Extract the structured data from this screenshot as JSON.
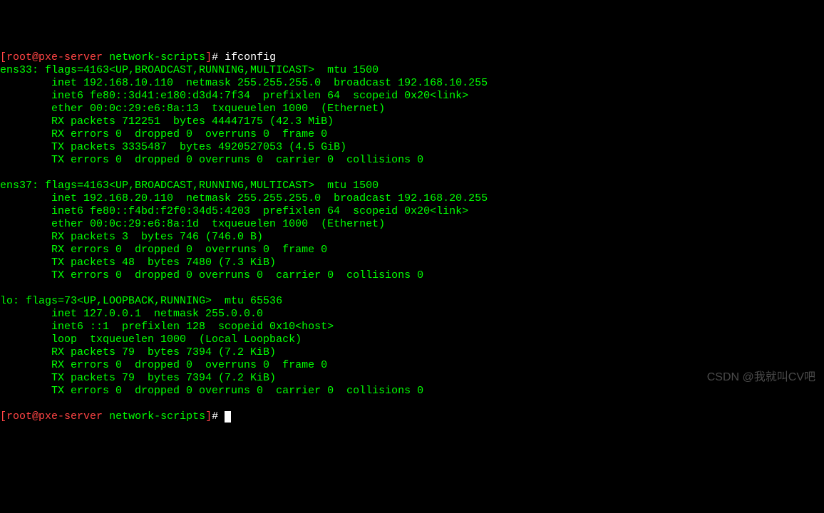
{
  "prompt1": {
    "open": "[",
    "user": "root",
    "at": "@",
    "host": "pxe-server",
    "space": " ",
    "path": "network-scripts",
    "close": "]",
    "hash": "# ",
    "cmd": "ifconfig"
  },
  "ens33": {
    "l1": "ens33: flags=4163<UP,BROADCAST,RUNNING,MULTICAST>  mtu 1500",
    "l2": "        inet 192.168.10.110  netmask 255.255.255.0  broadcast 192.168.10.255",
    "l3": "        inet6 fe80::3d41:e180:d3d4:7f34  prefixlen 64  scopeid 0x20<link>",
    "l4": "        ether 00:0c:29:e6:8a:13  txqueuelen 1000  (Ethernet)",
    "l5": "        RX packets 712251  bytes 44447175 (42.3 MiB)",
    "l6": "        RX errors 0  dropped 0  overruns 0  frame 0",
    "l7": "        TX packets 3335487  bytes 4920527053 (4.5 GiB)",
    "l8": "        TX errors 0  dropped 0 overruns 0  carrier 0  collisions 0"
  },
  "ens37": {
    "l1": "ens37: flags=4163<UP,BROADCAST,RUNNING,MULTICAST>  mtu 1500",
    "l2": "        inet 192.168.20.110  netmask 255.255.255.0  broadcast 192.168.20.255",
    "l3": "        inet6 fe80::f4bd:f2f0:34d5:4203  prefixlen 64  scopeid 0x20<link>",
    "l4": "        ether 00:0c:29:e6:8a:1d  txqueuelen 1000  (Ethernet)",
    "l5": "        RX packets 3  bytes 746 (746.0 B)",
    "l6": "        RX errors 0  dropped 0  overruns 0  frame 0",
    "l7": "        TX packets 48  bytes 7480 (7.3 KiB)",
    "l8": "        TX errors 0  dropped 0 overruns 0  carrier 0  collisions 0"
  },
  "lo": {
    "l1": "lo: flags=73<UP,LOOPBACK,RUNNING>  mtu 65536",
    "l2": "        inet 127.0.0.1  netmask 255.0.0.0",
    "l3": "        inet6 ::1  prefixlen 128  scopeid 0x10<host>",
    "l4": "        loop  txqueuelen 1000  (Local Loopback)",
    "l5": "        RX packets 79  bytes 7394 (7.2 KiB)",
    "l6": "        RX errors 0  dropped 0  overruns 0  frame 0",
    "l7": "        TX packets 79  bytes 7394 (7.2 KiB)",
    "l8": "        TX errors 0  dropped 0 overruns 0  carrier 0  collisions 0"
  },
  "prompt2": {
    "open": "[",
    "user": "root",
    "at": "@",
    "host": "pxe-server",
    "space": " ",
    "path": "network-scripts",
    "close": "]",
    "hash": "# "
  },
  "watermark": "CSDN @我就叫CV吧"
}
